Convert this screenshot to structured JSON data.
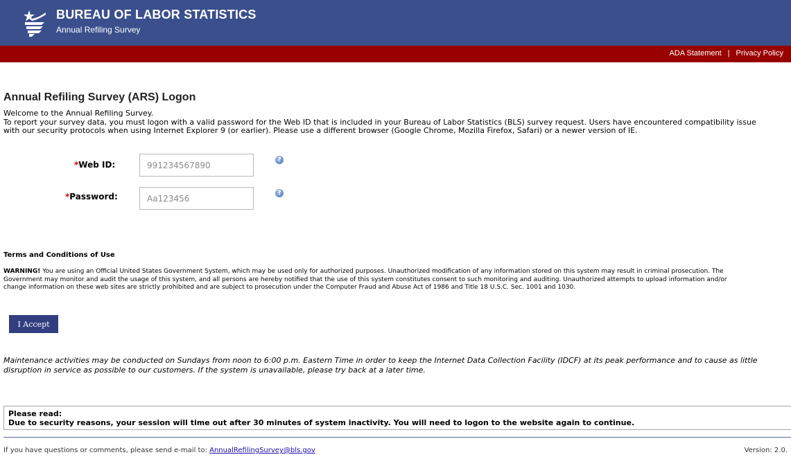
{
  "header": {
    "org_name": "BUREAU OF LABOR STATISTICS",
    "app_name": "Annual Refiling Survey",
    "logo_icon": "bls-star-flag-logo",
    "background_color": "#3a4f8c"
  },
  "topbar": {
    "background_color": "#990000",
    "links": [
      "ADA Statement",
      "Privacy Policy"
    ],
    "separator": "|"
  },
  "page_title": "Annual Refiling Survey (ARS) Logon",
  "intro": {
    "line1": "Welcome to the Annual Refiling Survey.",
    "line2": "To report your survey data, you must logon with a valid password for the Web ID that is included in your Bureau of Labor Statistics (BLS) survey request. Users have encountered compatibility issue",
    "line3": "with our security protocols when using Internet Explorer 9 (or earlier). Please use a different browser (Google Chrome, Mozilla Firefox, Safari) or a newer version of IE."
  },
  "form": {
    "required_marker": "*",
    "webid_label": "Web ID:",
    "webid_value": "991234567890",
    "password_label": "Password:",
    "password_value": "Aa123456",
    "help_icon": "help-question-icon"
  },
  "terms": {
    "title": "Terms and Conditions of Use",
    "warning_label": "WARNING!",
    "line1": " You are using an Official United States Government System, which may be used only for authorized purposes. Unauthorized modification of any information stored on this system may result in criminal prosecution. The",
    "line2": "Government may monitor and audit the usage of this system, and all persons are hereby notified that the use of this system constitutes consent to such monitoring and auditing. Unauthorized attempts to upload information and/or",
    "line3": "change information on these web sites are strictly prohibited and are subject to prosecution under the Computer Fraud and Abuse Act of 1986 and Title 18 U.S.C. Sec. 1001 and 1030."
  },
  "accept_button": "I Accept",
  "maintenance": {
    "line1": "Maintenance activities may be conducted on Sundays from noon to 6:00 p.m. Eastern Time in order to keep the Internet Data Collection Facility (IDCF) at its peak performance and to cause as little",
    "line2": "disruption in service as possible to our customers. If the system is unavailable, please try back at a later time."
  },
  "notice": {
    "heading": "Please read:",
    "text": "Due to security reasons, your session will time out after 30 minutes of system inactivity. You will need to logon to the website again to continue."
  },
  "footer": {
    "contact_text": "If you have questions or comments, please send e-mail to: ",
    "email": "AnnualRefilingSurvey@bls.gov",
    "version": "Version: 2.0."
  }
}
